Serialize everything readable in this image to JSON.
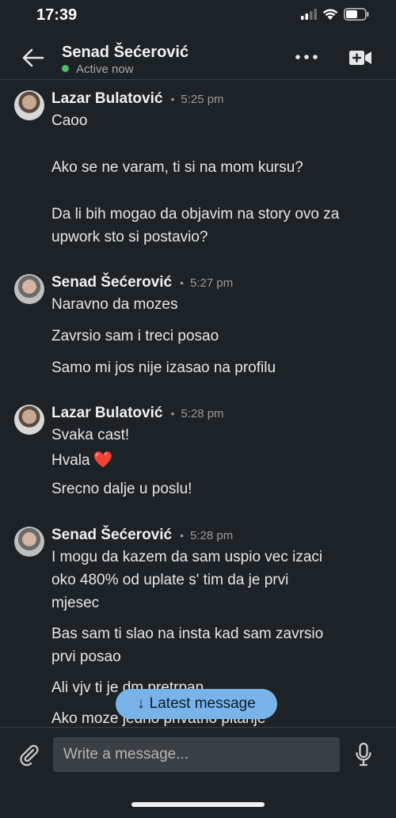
{
  "status_bar": {
    "time": "17:39",
    "signal_icon": "cellular-signal-icon",
    "wifi_icon": "wifi-icon",
    "battery_icon": "battery-icon"
  },
  "header": {
    "contact_name": "Senad Šećerović",
    "presence": "Active now",
    "back_icon": "arrow-left-icon",
    "more_icon": "more-dots-icon",
    "video_icon": "video-call-icon"
  },
  "colors": {
    "background": "#1d2226",
    "online": "#4fbf6a",
    "pill": "#79b3ea",
    "heart": "#e3343a"
  },
  "messages": [
    {
      "sender": "Lazar Bulatović",
      "separator": "•",
      "time": "5:25 pm",
      "lines": [
        "Caoo",
        "Ako se ne varam, ti si na mom kursu?",
        "Da li bih mogao da objavim na story ovo za",
        "upwork sto si postavio?"
      ]
    },
    {
      "sender": "Senad Šećerović",
      "separator": "•",
      "time": "5:27 pm",
      "lines": [
        "Naravno da mozes",
        "Zavrsio sam i treci posao",
        "Samo mi jos nije izasao na profilu"
      ]
    },
    {
      "sender": "Lazar Bulatović",
      "separator": "•",
      "time": "5:28 pm",
      "lines": [
        "Svaka cast!",
        "Hvala",
        "Srecno dalje u poslu!"
      ],
      "heart": "❤️"
    },
    {
      "sender": "Senad Šećerović",
      "separator": "•",
      "time": "5:28 pm",
      "lines": [
        "I mogu da kazem da sam uspio vec izaci",
        "oko 480% od uplate s' tim da je prvi",
        "mjesec",
        "Bas sam ti slao na insta kad sam zavrsio",
        "prvi posao",
        "Ali vjv ti je dm pretrpan",
        "Ako moze jedno privatno pitanje"
      ]
    }
  ],
  "latest_pill": {
    "label": "Latest message",
    "arrow": "↓"
  },
  "composer": {
    "placeholder": "Write a message...",
    "attach_icon": "paperclip-icon",
    "mic_icon": "microphone-icon"
  }
}
